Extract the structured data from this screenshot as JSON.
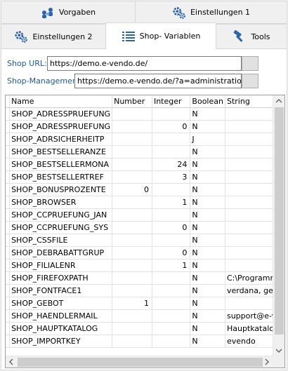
{
  "tabs": [
    {
      "label": "Vorgaben",
      "icon": "people-icon"
    },
    {
      "label": "Einstellungen 1",
      "icon": "gears-icon"
    },
    {
      "label": "Einstellungen 2",
      "icon": "gears-icon"
    },
    {
      "label": "Shop- Variablen",
      "icon": "list-icon",
      "active": true
    },
    {
      "label": "Tools",
      "icon": "hammer-icon"
    }
  ],
  "fields": {
    "shop_url_label": "Shop URL:",
    "shop_url_value": "https://demo.e-vendo.de/",
    "shop_mgmt_label": "Shop-Management:",
    "shop_mgmt_value": "https://demo.e-vendo.de/?a=administration"
  },
  "grid": {
    "columns": [
      "Name",
      "Number",
      "Integer",
      "Boolean",
      "String"
    ],
    "rows": [
      [
        "SHOP_ADRESSPRUEFUNG",
        "",
        "",
        "N",
        ""
      ],
      [
        "SHOP_ADRESSPRUEFUNG",
        "",
        "0",
        "N",
        ""
      ],
      [
        "SHOP_ADRSICHERHEITP",
        "",
        "",
        "J",
        ""
      ],
      [
        "SHOP_BESTSELLERANZE",
        "",
        "",
        "N",
        ""
      ],
      [
        "SHOP_BESTSELLERMONA",
        "",
        "24",
        "N",
        ""
      ],
      [
        "SHOP_BESTSELLERTREF",
        "",
        "3",
        "N",
        ""
      ],
      [
        "SHOP_BONUSPROZENTE",
        "0",
        "",
        "N",
        ""
      ],
      [
        "SHOP_BROWSER",
        "",
        "1",
        "N",
        ""
      ],
      [
        "SHOP_CCPRUEFUNG_JAN",
        "",
        "",
        "N",
        ""
      ],
      [
        "SHOP_CCPRUEFUNG_SYS",
        "",
        "0",
        "N",
        ""
      ],
      [
        "SHOP_CSSFILE",
        "",
        "",
        "N",
        ""
      ],
      [
        "SHOP_DEBRABATTGRUP",
        "",
        "0",
        "N",
        ""
      ],
      [
        "SHOP_FILIALENR",
        "",
        "1",
        "N",
        ""
      ],
      [
        "SHOP_FIREFOXPATH",
        "",
        "",
        "N",
        "C:\\Programme"
      ],
      [
        "SHOP_FONTFACE1",
        "",
        "",
        "N",
        "verdana, ge"
      ],
      [
        "SHOP_GEBOT",
        "1",
        "",
        "N",
        ""
      ],
      [
        "SHOP_HAENDLERMAIL",
        "",
        "",
        "N",
        "support@e-v"
      ],
      [
        "SHOP_HAUPTKATALOG",
        "",
        "",
        "N",
        "Hauptkatalo"
      ],
      [
        "SHOP_IMPORTKEY",
        "",
        "",
        "N",
        "evendo"
      ]
    ]
  },
  "colors": {
    "label_blue": "#1e5aa8",
    "icon_blue": "#2b63b0"
  }
}
